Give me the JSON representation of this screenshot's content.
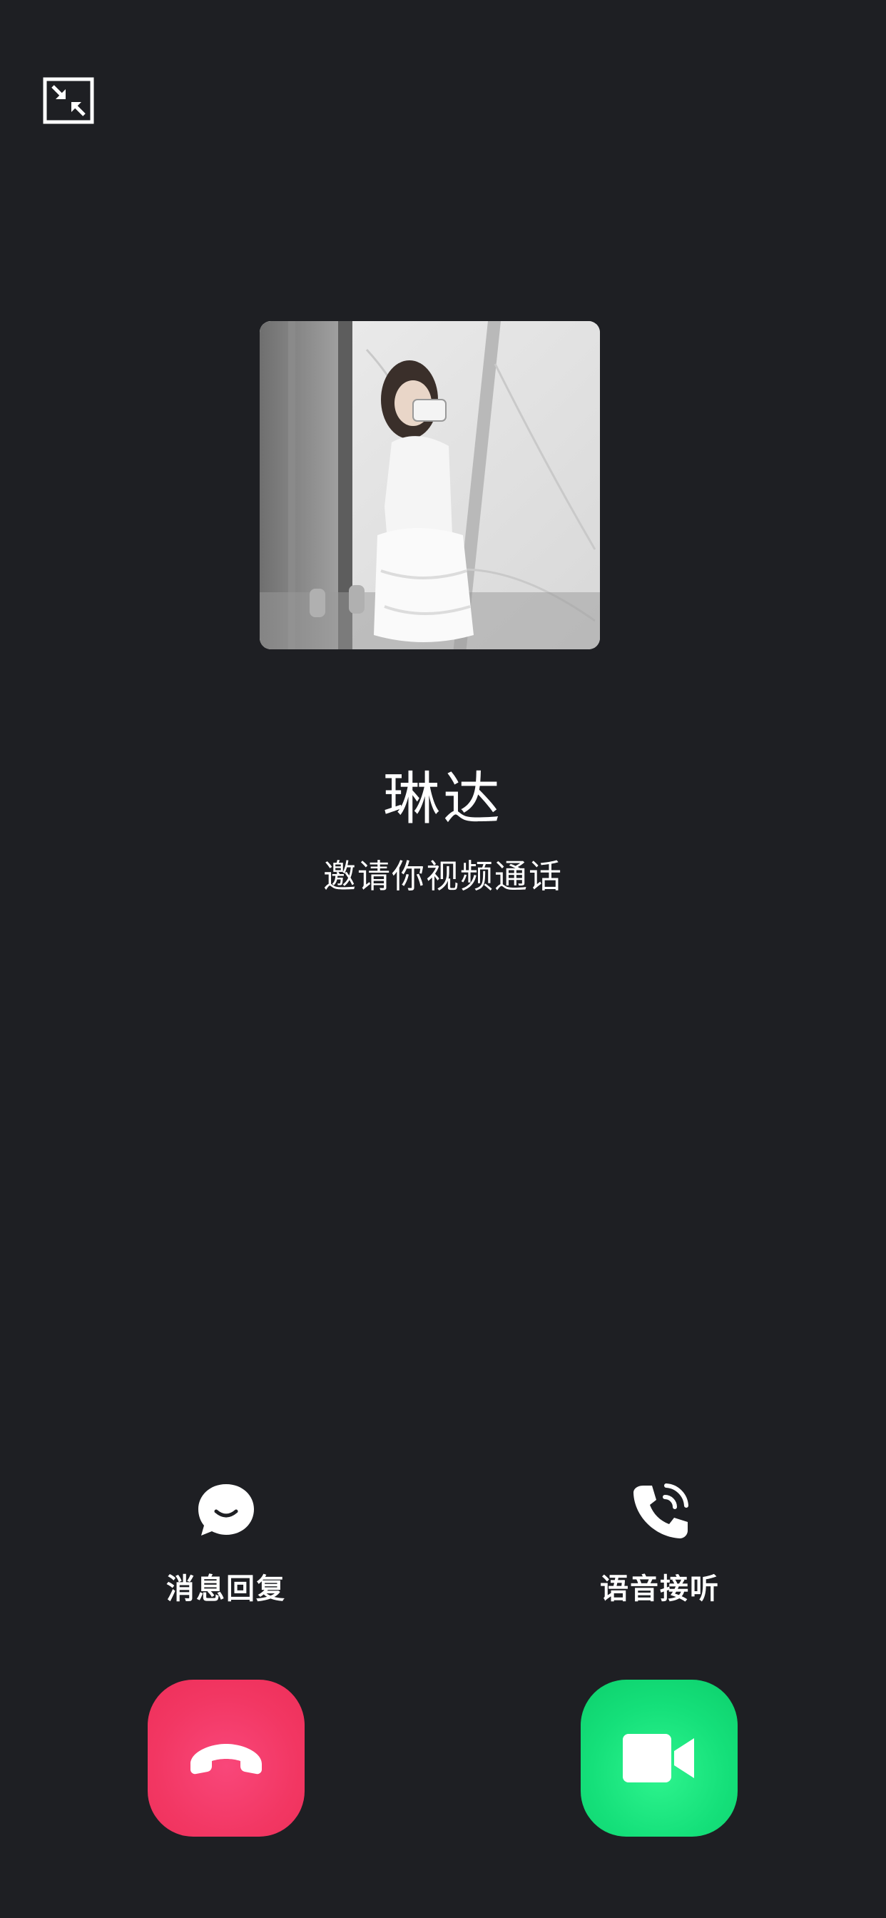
{
  "call": {
    "caller_name": "琳达",
    "subtitle": "邀请你视频通话"
  },
  "actions": {
    "message_reply_label": "消息回复",
    "voice_answer_label": "语音接听"
  },
  "icons": {
    "minimize": "minimize-icon",
    "message": "chat-bubble-icon",
    "voice": "phone-answer-icon",
    "decline": "hang-up-icon",
    "accept": "video-camera-icon"
  },
  "colors": {
    "background": "#1e1f23",
    "decline": "#f23763",
    "accept": "#15e07a",
    "text": "#ffffff"
  }
}
